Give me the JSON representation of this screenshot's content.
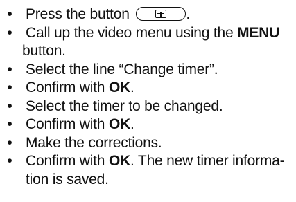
{
  "steps": [
    {
      "before": "Press the button",
      "after": "."
    },
    {
      "before": "Call up the video menu using the ",
      "bold": "MENU",
      "after": " button."
    },
    {
      "text": "Select the line “Change timer”."
    },
    {
      "before": "Confirm with ",
      "bold": "OK",
      "after": "."
    },
    {
      "text": "Select the timer to be changed."
    },
    {
      "before": "Confirm with ",
      "bold": "OK",
      "after": "."
    },
    {
      "text": "Make the corrections."
    },
    {
      "before": "Confirm with ",
      "bold": "OK",
      "after": ". The new timer informa-"
    },
    {
      "text": "tion is saved."
    }
  ],
  "bullet": "•",
  "icons": {
    "key_button": "plus-key-icon"
  }
}
